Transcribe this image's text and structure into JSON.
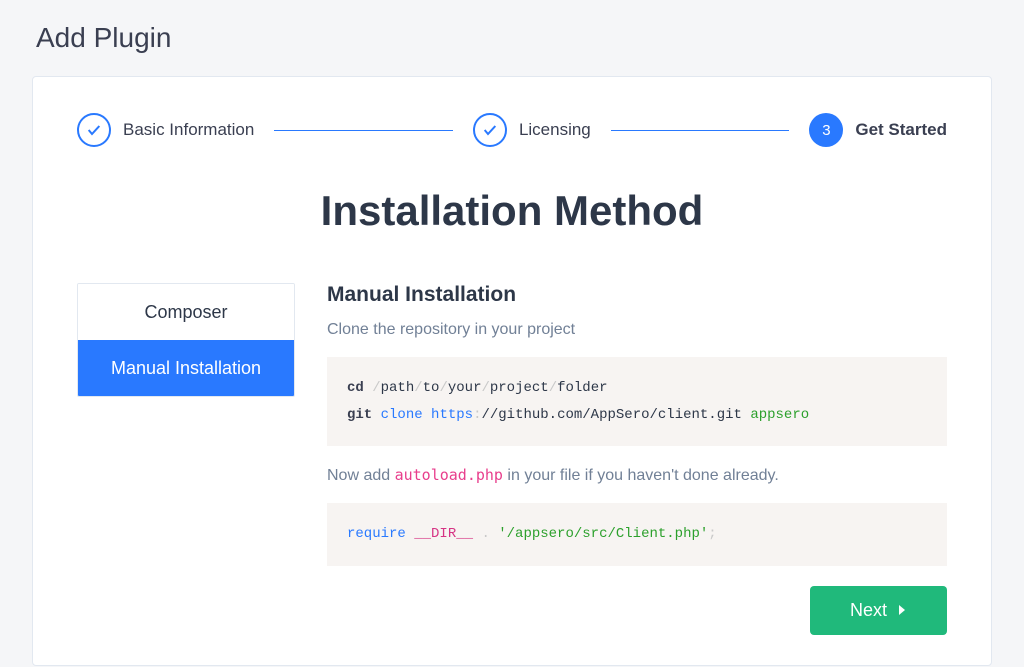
{
  "page_title": "Add Plugin",
  "stepper": {
    "steps": [
      {
        "label": "Basic Information",
        "state": "done"
      },
      {
        "label": "Licensing",
        "state": "done"
      },
      {
        "label": "Get Started",
        "state": "current",
        "number": "3"
      }
    ]
  },
  "section_title": "Installation Method",
  "tabs": [
    {
      "label": "Composer",
      "active": false
    },
    {
      "label": "Manual Installation",
      "active": true
    }
  ],
  "content": {
    "heading": "Manual Installation",
    "intro": "Clone the repository in your project",
    "block1": {
      "cd": "cd",
      "path_parts": [
        "path",
        "to",
        "your",
        "project",
        "folder"
      ],
      "git": "git",
      "clone": "clone",
      "https": "https",
      "url_rest": "//github.com/AppSero/client.git",
      "target": "appsero"
    },
    "mid_pre": "Now add ",
    "mid_code": "autoload.php",
    "mid_post": " in your file if you haven't done already.",
    "block2": {
      "require": "require",
      "dir": "__DIR__",
      "dot": ".",
      "str": "'/appsero/src/Client.php'",
      "semi": ";"
    }
  },
  "next_label": "Next"
}
